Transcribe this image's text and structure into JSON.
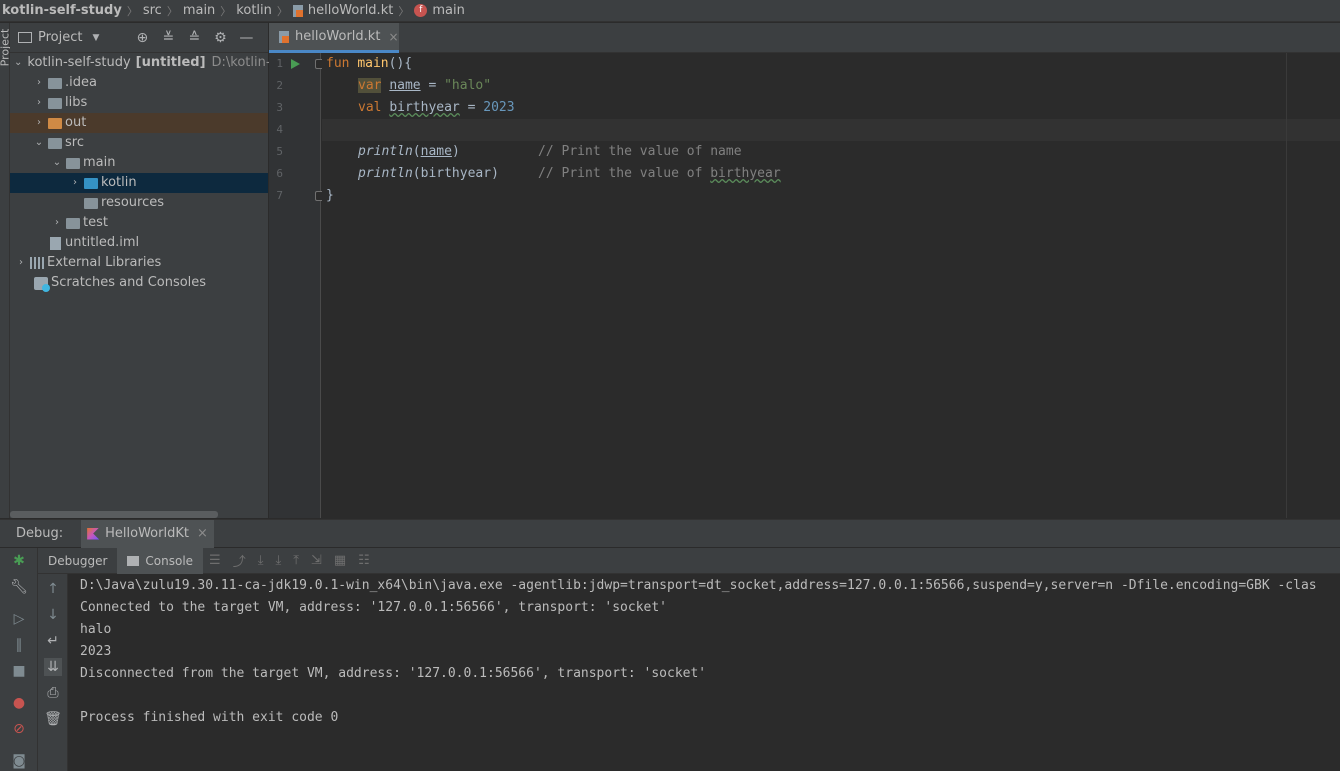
{
  "breadcrumb": {
    "project": "kotlin-self-study",
    "items": [
      "src",
      "main",
      "kotlin",
      "helloWorld.kt",
      "main"
    ]
  },
  "left_strip": {
    "label": "Project"
  },
  "project_panel": {
    "title": "Project",
    "tree": [
      {
        "label": "kotlin-self-study",
        "suffix": "[untitled]",
        "path": "D:\\kotlin-"
      },
      {
        "label": ".idea"
      },
      {
        "label": "libs"
      },
      {
        "label": "out"
      },
      {
        "label": "src"
      },
      {
        "label": "main"
      },
      {
        "label": "kotlin"
      },
      {
        "label": "resources"
      },
      {
        "label": "test"
      },
      {
        "label": "untitled.iml"
      },
      {
        "label": "External Libraries"
      },
      {
        "label": "Scratches and Consoles"
      }
    ]
  },
  "editor": {
    "tab_label": "helloWorld.kt",
    "line_numbers": [
      "1",
      "2",
      "3",
      "4",
      "5",
      "6",
      "7"
    ],
    "code": {
      "l1_kw": "fun",
      "l1_fn": "main",
      "l1_rest": "(){",
      "l2_kw": "var",
      "l2_name": "name",
      "l2_eq": " = ",
      "l2_str": "\"halo\"",
      "l3_kw": "val",
      "l3_name": "birthyear",
      "l3_eq": " = ",
      "l3_num": "2023",
      "l5_fn": "println",
      "l5_arg_open": "(",
      "l5_arg": "name",
      "l5_arg_close": ")",
      "l5_cmt": "// Print the value of name",
      "l6_fn": "println",
      "l6_arg": "(birthyear)",
      "l6_cmt": "// Print the value of ",
      "l6_cmt_word": "birthyear",
      "l7": "}"
    }
  },
  "debug": {
    "label": "Debug:",
    "tab_label": "HelloWorldKt",
    "subtabs": {
      "debugger": "Debugger",
      "console": "Console"
    },
    "console_lines": [
      "D:\\Java\\zulu19.30.11-ca-jdk19.0.1-win_x64\\bin\\java.exe -agentlib:jdwp=transport=dt_socket,address=127.0.0.1:56566,suspend=y,server=n -Dfile.encoding=GBK -clas",
      "Connected to the target VM, address: '127.0.0.1:56566', transport: 'socket'",
      "halo",
      "2023",
      "Disconnected from the target VM, address: '127.0.0.1:56566', transport: 'socket'",
      "",
      "Process finished with exit code 0"
    ]
  },
  "colors": {
    "keyword": "#cc7832",
    "function": "#ffc66d",
    "string": "#6a8759",
    "number": "#6897bb",
    "comment": "#808080",
    "selection": "#0d293e"
  }
}
